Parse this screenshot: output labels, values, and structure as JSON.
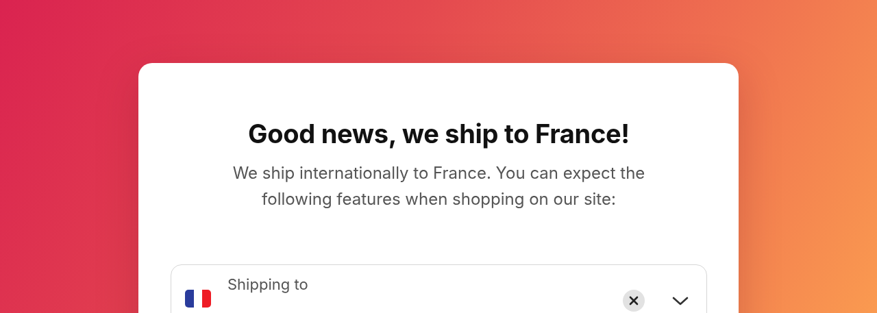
{
  "dialog": {
    "title": "Good news, we ship to France!",
    "description": "We ship internationally to France. You can expect the following features when shopping on our site:",
    "country_field": {
      "label": "Shipping to"
    }
  }
}
